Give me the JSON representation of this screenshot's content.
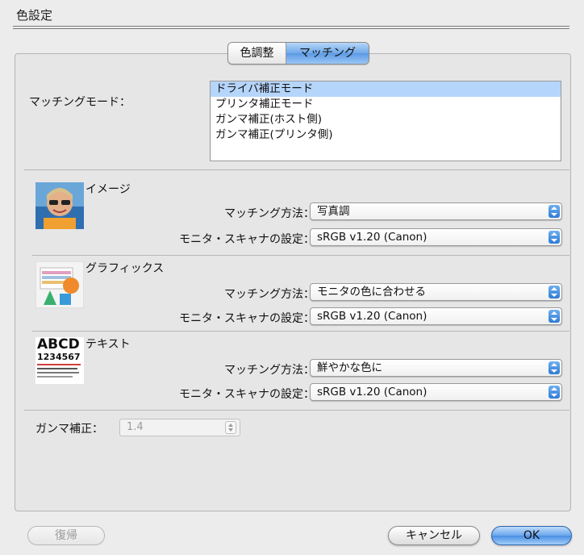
{
  "window": {
    "title": "色設定"
  },
  "tabs": [
    {
      "label": "色調整",
      "active": false
    },
    {
      "label": "マッチング",
      "active": true
    }
  ],
  "matching_mode": {
    "label": "マッチングモード：",
    "options": [
      "ドライバ補正モード",
      "プリンタ補正モード",
      "ガンマ補正(ホスト側)",
      "ガンマ補正(プリンタ側)"
    ],
    "selected_index": 0
  },
  "sections": [
    {
      "title": "イメージ",
      "icon": "photo-child-icon",
      "method_label": "マッチング方法：",
      "method_value": "写真調",
      "monitor_label": "モニタ・スキャナの設定：",
      "monitor_value": "sRGB v1.20 (Canon)"
    },
    {
      "title": "グラフィックス",
      "icon": "graphics-chart-icon",
      "method_label": "マッチング方法：",
      "method_value": "モニタの色に合わせる",
      "monitor_label": "モニタ・スキャナの設定：",
      "monitor_value": "sRGB v1.20 (Canon)"
    },
    {
      "title": "テキスト",
      "icon": "text-sample-icon",
      "method_label": "マッチング方法：",
      "method_value": "鮮やかな色に",
      "monitor_label": "モニタ・スキャナの設定：",
      "monitor_value": "sRGB v1.20 (Canon)"
    }
  ],
  "text_icon": {
    "line1": "ABCD",
    "line2": "1234567"
  },
  "gamma": {
    "label": "ガンマ補正：",
    "value": "1.4"
  },
  "buttons": {
    "restore": "復帰",
    "cancel": "キャンセル",
    "ok": "OK"
  },
  "colors": {
    "accent": "#5c9ae4",
    "selection": "#b5d5fb"
  }
}
